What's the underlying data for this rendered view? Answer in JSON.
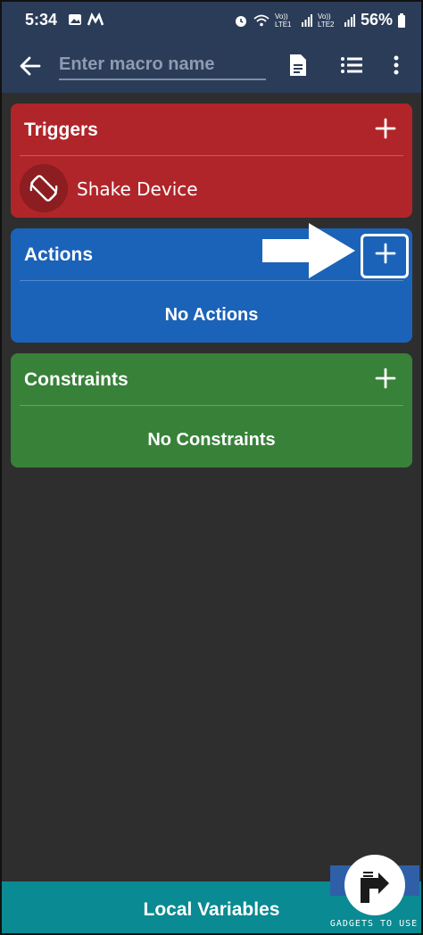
{
  "status_bar": {
    "time": "5:34",
    "network_1": "Vo)) LTE1",
    "network_2": "Vo)) LTE2",
    "battery": "56%",
    "icons": [
      "gallery-icon",
      "m-icon",
      "alarm-icon",
      "wifi-icon",
      "signal-icon",
      "signal-icon",
      "battery-icon"
    ]
  },
  "toolbar": {
    "macro_name_placeholder": "Enter macro name",
    "macro_name_value": "",
    "icons": [
      "back-arrow-icon",
      "document-icon",
      "list-icon",
      "more-vert-icon"
    ]
  },
  "triggers": {
    "title": "Triggers",
    "color": "#b02529",
    "items": [
      {
        "label": "Shake Device",
        "icon": "screen-rotation-icon"
      }
    ]
  },
  "actions": {
    "title": "Actions",
    "color": "#1b63b8",
    "empty_text": "No Actions"
  },
  "constraints": {
    "title": "Constraints",
    "color": "#388139",
    "empty_text": "No Constraints"
  },
  "bottom_bar": {
    "label": "Local Variables",
    "color": "#0a8a92"
  },
  "watermark": {
    "text": "GADGETS TO USE"
  }
}
